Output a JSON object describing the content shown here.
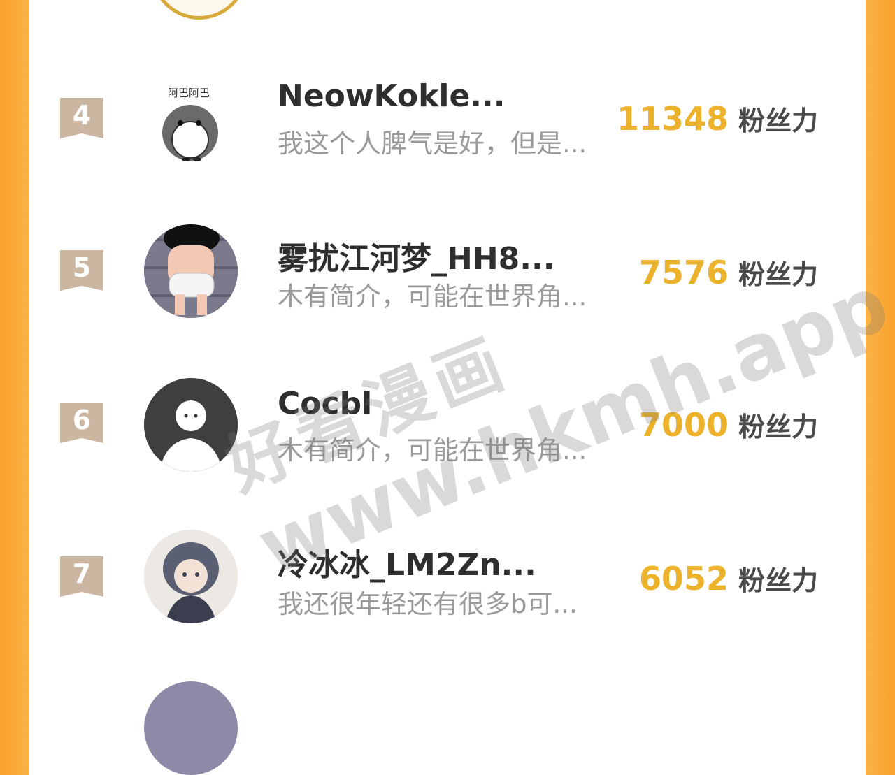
{
  "leaderboard": {
    "fans_unit": "粉丝力",
    "rows": [
      {
        "rank": "4",
        "name": "NeowKokle...",
        "bio": "我这个人脾气是好，但是...",
        "fans": "11348"
      },
      {
        "rank": "5",
        "name": "雾扰江河梦_HH8...",
        "bio": "木有简介，可能在世界角...",
        "fans": "7576"
      },
      {
        "rank": "6",
        "name": "Cocbl",
        "bio": "木有简介，可能在世界角...",
        "fans": "7000"
      },
      {
        "rank": "7",
        "name": "冷冰冰_LM2Zn...",
        "bio": "我还很年轻还有很多b可...",
        "fans": "6052"
      }
    ]
  },
  "watermark": {
    "cn": "好看漫画",
    "url": "www.hkmh.app"
  },
  "colors": {
    "side_orange": "#f9a12b",
    "fans_gold": "#edb22c",
    "badge": "#cbb6a2"
  }
}
